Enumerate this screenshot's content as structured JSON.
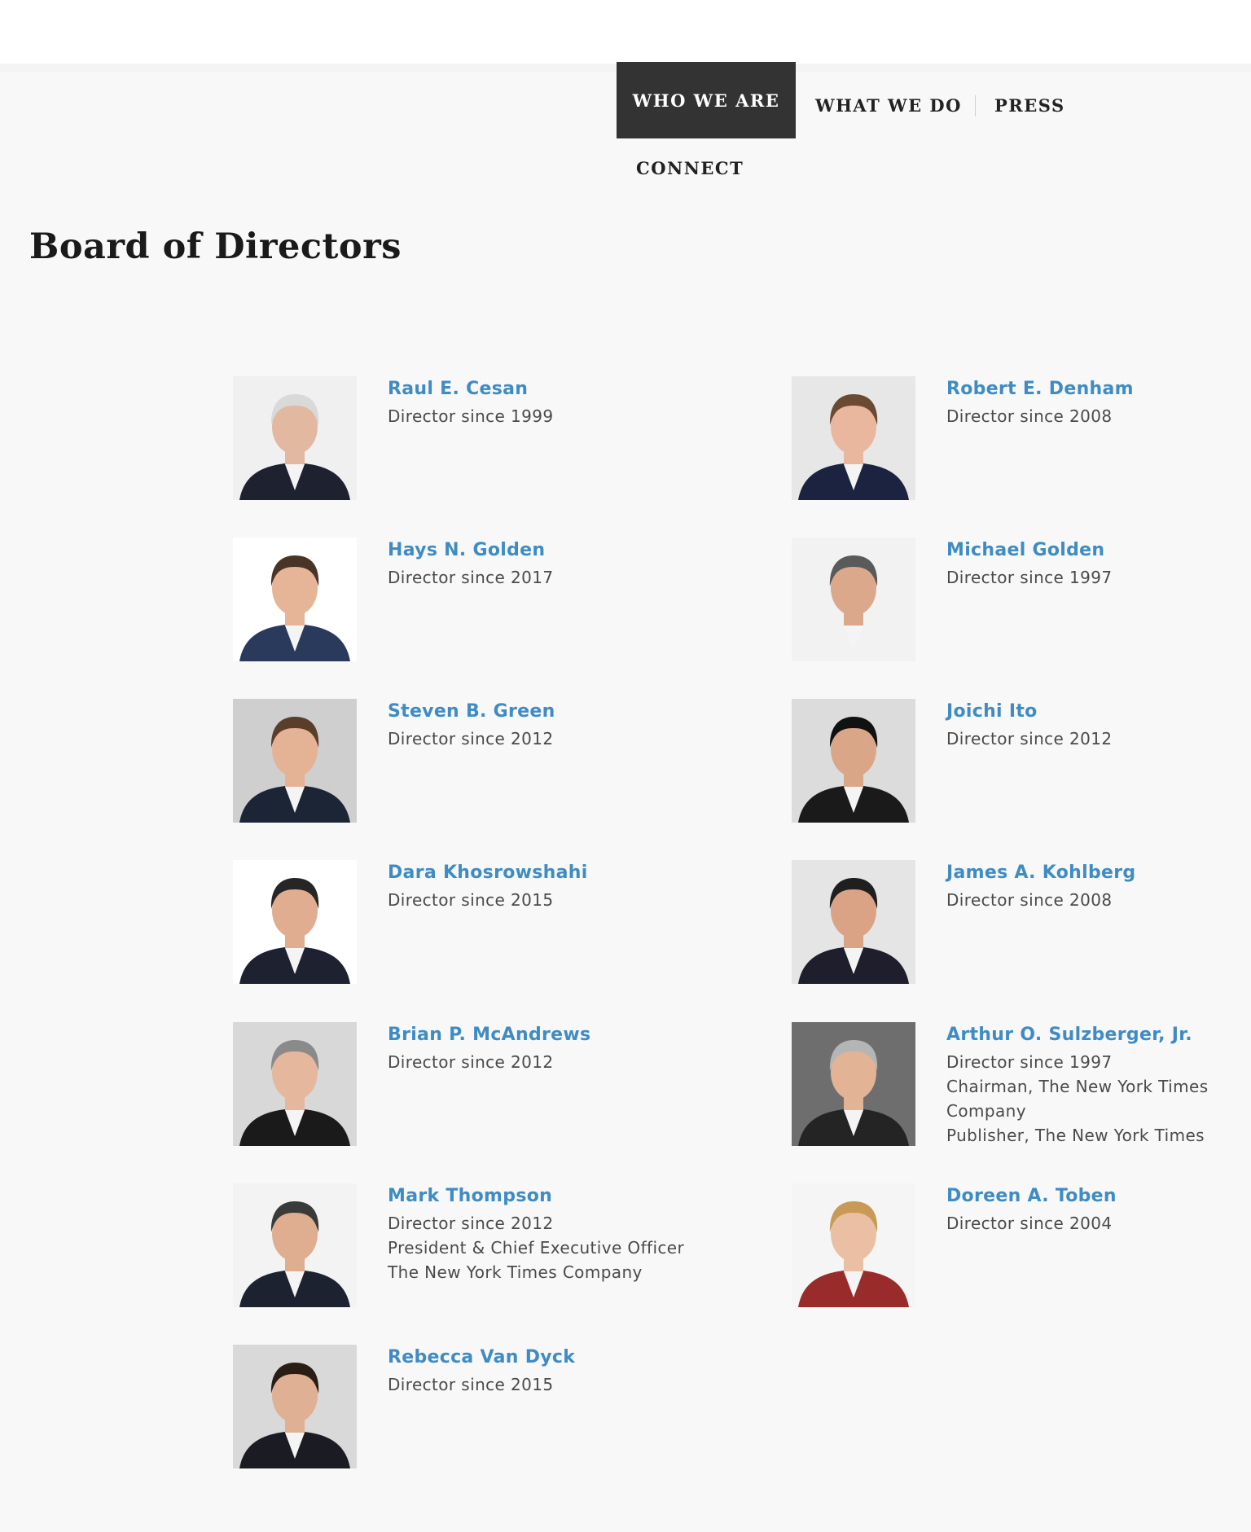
{
  "nav": {
    "items": [
      {
        "label": "WHO WE ARE",
        "active": true
      },
      {
        "label": "WHAT WE DO",
        "active": false
      },
      {
        "label": "PRESS",
        "active": false
      },
      {
        "label": "CONNECT",
        "active": false
      }
    ]
  },
  "page": {
    "title": "Board of Directors"
  },
  "directors": [
    {
      "name": "Raul E. Cesan",
      "lines": [
        "Director since 1999"
      ]
    },
    {
      "name": "Robert E. Denham",
      "lines": [
        "Director since 2008"
      ]
    },
    {
      "name": "Hays N. Golden",
      "lines": [
        "Director since 2017"
      ]
    },
    {
      "name": "Michael Golden",
      "lines": [
        "Director since 1997"
      ]
    },
    {
      "name": "Steven B. Green",
      "lines": [
        "Director since 2012"
      ]
    },
    {
      "name": "Joichi Ito",
      "lines": [
        "Director since 2012"
      ]
    },
    {
      "name": "Dara Khosrowshahi",
      "lines": [
        "Director since 2015"
      ]
    },
    {
      "name": "James A. Kohlberg",
      "lines": [
        "Director since 2008"
      ]
    },
    {
      "name": "Brian P. McAndrews",
      "lines": [
        "Director since 2012"
      ]
    },
    {
      "name": "Arthur O. Sulzberger, Jr.",
      "lines": [
        "Director since 1997",
        "Chairman, The New York Times",
        "Company",
        "Publisher, The New York Times"
      ]
    },
    {
      "name": "Mark Thompson",
      "lines": [
        "Director since 2012",
        "President & Chief Executive Officer",
        "The New York Times Company"
      ]
    },
    {
      "name": "Doreen A. Toben",
      "lines": [
        "Director since 2004"
      ]
    },
    {
      "name": "Rebecca Van Dyck",
      "lines": [
        "Director since 2015"
      ]
    }
  ],
  "colors": {
    "accent": "#3f8cc4",
    "nav_active_bg": "#333333",
    "text": "#4a4a4a",
    "page_bg": "#f8f8f8"
  }
}
